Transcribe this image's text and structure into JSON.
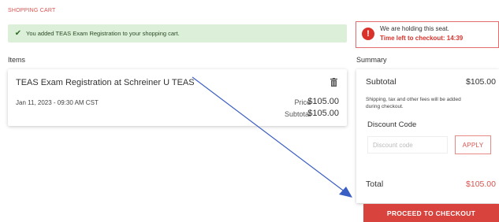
{
  "page": {
    "heading": "SHOPPING CART"
  },
  "banner": {
    "message": "You added TEAS Exam Registration to your shopping cart."
  },
  "items": {
    "label": "Items",
    "entries": [
      {
        "title": "TEAS Exam Registration at Schreiner U TEAS",
        "date": "Jan 11, 2023 - 09:30 AM CST",
        "price_label": "Price",
        "price": "$105.00",
        "subtotal_label": "Subtotal",
        "subtotal": "$105.00",
        "delete_icon": "trash-icon"
      }
    ]
  },
  "hold": {
    "line1": "We are holding this seat.",
    "line2": "Time left to checkout: 14:39",
    "icon": "alert-icon"
  },
  "summary": {
    "label": "Summary",
    "subtotal_label": "Subtotal",
    "subtotal_value": "$105.00",
    "note": "Shipping, tax and other fees will be added during checkout.",
    "discount_label": "Discount Code",
    "discount_placeholder": "Discount code",
    "apply_label": "APPLY",
    "total_label": "Total",
    "total_value": "$105.00"
  },
  "checkout": {
    "label": "PROCEED TO CHECKOUT"
  },
  "colors": {
    "accent": "#d9534f",
    "success_bg": "#dcefd8",
    "annotation_arrow": "#3a5fc4"
  }
}
